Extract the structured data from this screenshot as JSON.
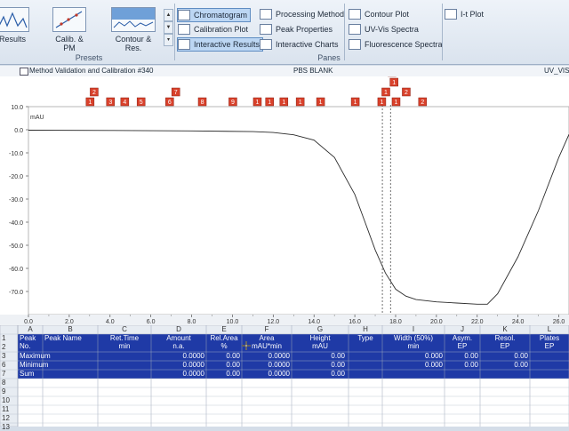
{
  "ribbon": {
    "buttons": [
      {
        "label": "Results"
      },
      {
        "label": "Calib. & PM"
      },
      {
        "label": "Contour & Res."
      }
    ],
    "presets_label": "Presets",
    "panes_label": "Panes",
    "panes_col1": [
      {
        "label": "Chromatogram",
        "active": true
      },
      {
        "label": "Calibration Plot",
        "active": false
      },
      {
        "label": "Interactive Results",
        "active": true
      }
    ],
    "panes_col2": [
      {
        "label": "Processing Method"
      },
      {
        "label": "Peak Properties"
      },
      {
        "label": "Interactive Charts"
      }
    ],
    "panes_col3": [
      {
        "label": "Contour Plot"
      },
      {
        "label": "UV-Vis Spectra"
      },
      {
        "label": "Fluorescence Spectra"
      }
    ],
    "panes_col4": [
      {
        "label": "I-t Plot"
      }
    ]
  },
  "window": {
    "title": "Method Validation and Calibration #340",
    "center_title": "PBS BLANK",
    "right_title": "UV_VIS"
  },
  "chart_data": {
    "type": "line",
    "ylabel": "mAU",
    "xlim": [
      0.0,
      26.5
    ],
    "ylim": [
      -80.0,
      10.0
    ],
    "x_ticks": [
      "0.0",
      "2.0",
      "4.0",
      "6.0",
      "8.0",
      "10.0",
      "12.0",
      "14.0",
      "16.0",
      "18.0",
      "20.0",
      "22.0",
      "24.0",
      "26.0"
    ],
    "y_ticks": [
      "10.0",
      "0.0",
      "-10.0",
      "-20.0",
      "-30.0",
      "-40.0",
      "-50.0",
      "-60.0",
      "-70.0"
    ],
    "x": [
      0.0,
      4.0,
      8.0,
      11.0,
      12.0,
      13.0,
      14.0,
      15.0,
      16.0,
      16.5,
      17.0,
      17.5,
      18.0,
      18.5,
      19.0,
      20.0,
      21.0,
      22.0,
      22.5,
      23.0,
      24.0,
      25.0,
      26.0,
      26.5
    ],
    "y": [
      -0.2,
      -0.3,
      -0.5,
      -0.8,
      -1.2,
      -2.2,
      -4.5,
      -12.0,
      -28.0,
      -40.0,
      -52.0,
      -62.0,
      -69.0,
      -72.0,
      -73.5,
      -74.5,
      -75.0,
      -75.5,
      -75.5,
      -71.0,
      -55.0,
      -35.0,
      -12.0,
      -2.0
    ],
    "dashed_lines_x": [
      17.35,
      17.75
    ],
    "peak_markers": [
      {
        "x": 3.0,
        "label": "1",
        "row": 0
      },
      {
        "x": 3.2,
        "label": "2",
        "row": 1
      },
      {
        "x": 4.0,
        "label": "3",
        "row": 0
      },
      {
        "x": 4.7,
        "label": "4",
        "row": 0
      },
      {
        "x": 5.5,
        "label": "5",
        "row": 0
      },
      {
        "x": 6.9,
        "label": "6",
        "row": 0
      },
      {
        "x": 7.2,
        "label": "7",
        "row": 1
      },
      {
        "x": 8.5,
        "label": "8",
        "row": 0
      },
      {
        "x": 10.0,
        "label": "9",
        "row": 0
      },
      {
        "x": 11.2,
        "label": "1",
        "row": 0
      },
      {
        "x": 11.8,
        "label": "1",
        "row": 0
      },
      {
        "x": 12.5,
        "label": "1",
        "row": 0
      },
      {
        "x": 13.3,
        "label": "1",
        "row": 0
      },
      {
        "x": 14.3,
        "label": "1",
        "row": 0
      },
      {
        "x": 16.0,
        "label": "1",
        "row": 0
      },
      {
        "x": 17.3,
        "label": "1",
        "row": 0
      },
      {
        "x": 17.5,
        "label": "1",
        "row": 1
      },
      {
        "x": 17.8,
        "label": "1",
        "row": 3
      },
      {
        "x": 17.9,
        "label": "1",
        "row": 2
      },
      {
        "x": 18.0,
        "label": "1",
        "row": 0
      },
      {
        "x": 18.5,
        "label": "2",
        "row": 1
      },
      {
        "x": 19.3,
        "label": "2",
        "row": 0
      }
    ]
  },
  "table": {
    "col_letters": [
      "A",
      "B",
      "C",
      "D",
      "E",
      "F",
      "G",
      "H",
      "I",
      "J",
      "K",
      "L"
    ],
    "row_numbers": [
      "1",
      "2",
      "3",
      "6",
      "7",
      "8",
      "9",
      "10",
      "11",
      "12",
      "13"
    ],
    "headers": [
      {
        "top": "Peak",
        "bottom": "No."
      },
      {
        "top": "Peak Name",
        "bottom": ""
      },
      {
        "top": "Ret.Time",
        "bottom": "min"
      },
      {
        "top": "Amount",
        "bottom": "n.a."
      },
      {
        "top": "Rel.Area",
        "bottom": "%"
      },
      {
        "top": "Area",
        "bottom": "mAU*min"
      },
      {
        "top": "Height",
        "bottom": "mAU"
      },
      {
        "top": "Type",
        "bottom": ""
      },
      {
        "top": "Width (50%)",
        "bottom": "min"
      },
      {
        "top": "Asym.",
        "bottom": "EP"
      },
      {
        "top": "Resol.",
        "bottom": "EP"
      },
      {
        "top": "Plates",
        "bottom": "EP"
      }
    ],
    "summary_rows": [
      {
        "label": "Maximum",
        "amount": "0.0000",
        "relarea": "0.00",
        "area": "0.0000",
        "height": "0.00",
        "width": "0.000",
        "asym": "0.00",
        "resol": "0.00"
      },
      {
        "label": "Minimum",
        "amount": "0.0000",
        "relarea": "0.00",
        "area": "0.0000",
        "height": "0.00",
        "width": "0.000",
        "asym": "0.00",
        "resol": "0.00"
      },
      {
        "label": "Sum",
        "amount": "0.0000",
        "relarea": "0.00",
        "area": "0.0000",
        "height": "0.00",
        "width": "",
        "asym": "",
        "resol": ""
      }
    ]
  }
}
